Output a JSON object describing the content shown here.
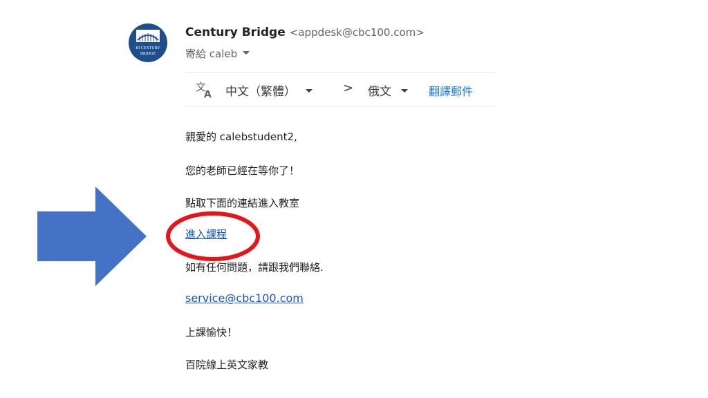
{
  "header": {
    "avatar_text_top": "BI CENTURY",
    "avatar_text_bottom": "BRIDGE",
    "sender_name": "Century Bridge",
    "sender_email": "<appdesk@cbc100.com>",
    "recipient_label": "寄給 caleb"
  },
  "translate_bar": {
    "icon": "translate-icon",
    "from_language": "中文（繁體）",
    "separator": ">",
    "to_language": "俄文",
    "translate_action": "翻譯郵件"
  },
  "body": {
    "greeting": "親愛的 calebstudent2,",
    "line1": "您的老師已經在等你了！",
    "line2": "點取下面的連結進入教室",
    "course_link": "進入課程",
    "line3": "如有任何問題，請跟我們聯絡.",
    "service_email": "service@cbc100.com",
    "line4": "上課愉快！",
    "signature": "百院線上英文家教"
  },
  "annotations": {
    "arrow_color": "#4472c4",
    "circle_color": "#e8141c"
  },
  "colors": {
    "link": "#1155cc",
    "action_blue": "#1a73e8",
    "avatar_bg": "#1f4e8c"
  }
}
